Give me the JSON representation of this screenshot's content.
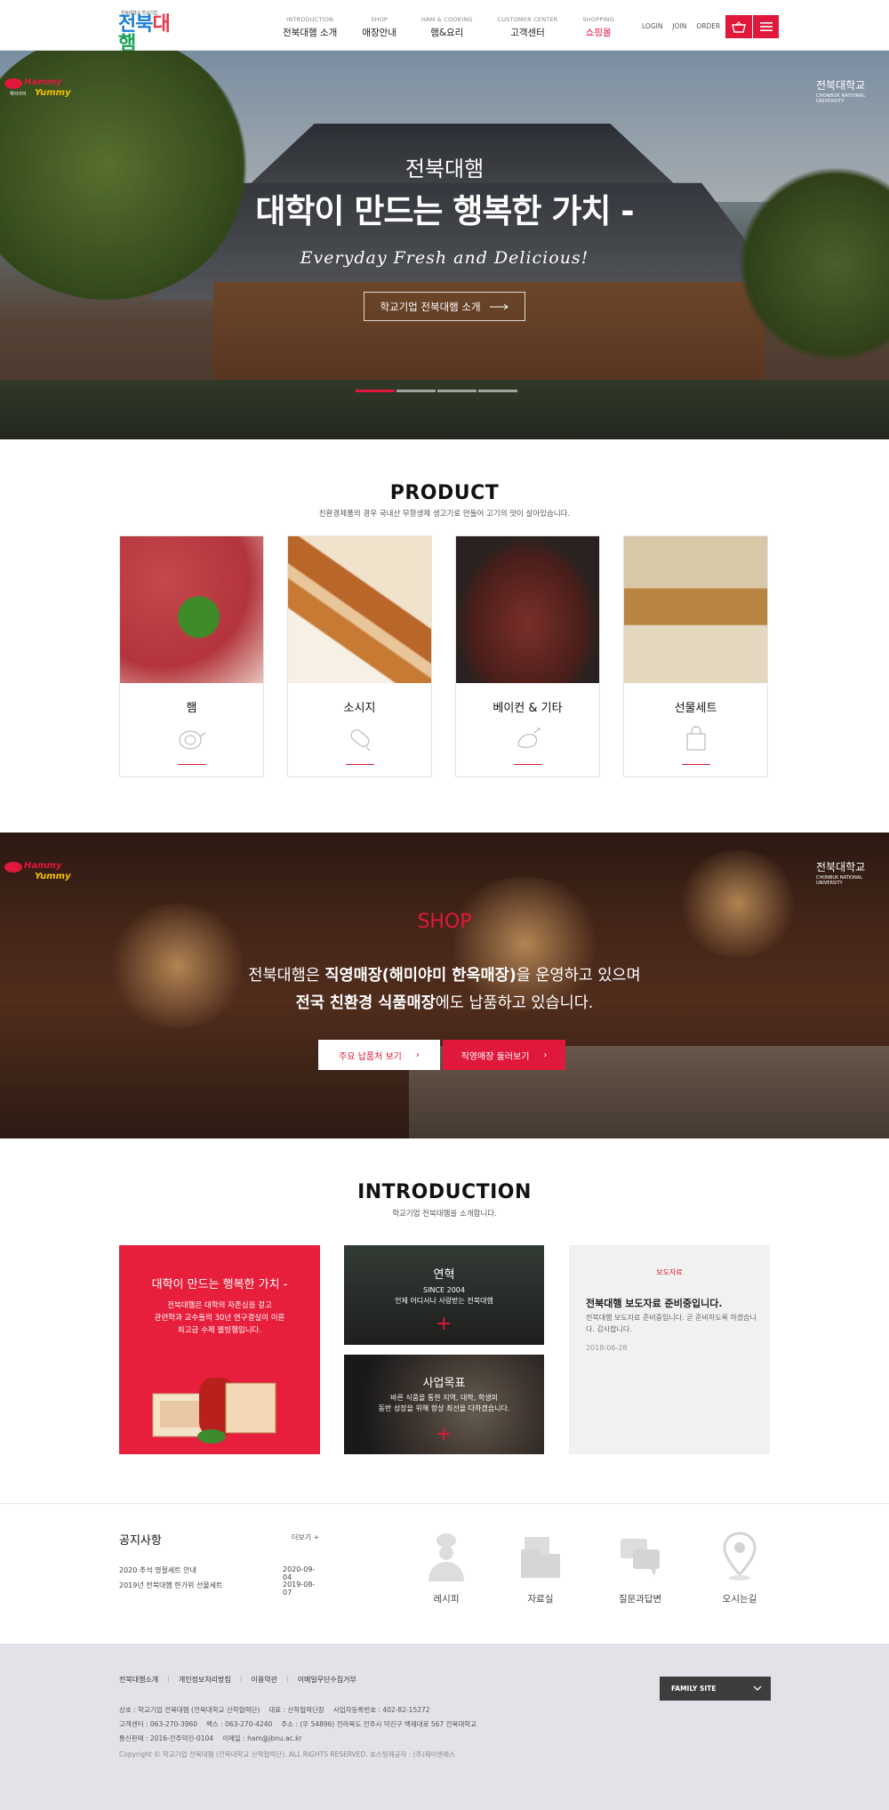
{
  "header": {
    "logo_sub": "전북대학교 학교기업",
    "logo_text": [
      "전북",
      "대",
      "햄"
    ],
    "nav": [
      {
        "en": "INTRODUCTION",
        "ko": "전북대햄 소개"
      },
      {
        "en": "SHOP",
        "ko": "매장안내"
      },
      {
        "en": "HAM & COOKING",
        "ko": "햄&요리"
      },
      {
        "en": "CUSTOMER CENTER",
        "ko": "고객센터"
      },
      {
        "en": "SHOPPING",
        "ko": "쇼핑몰"
      }
    ],
    "util": [
      "LOGIN",
      "JOIN",
      "ORDER"
    ]
  },
  "hero": {
    "brand_badge": "Hammy Yummy",
    "brand_badge_sub": "해미야미",
    "univ_badge": "전북대학교",
    "univ_badge_en": "CHONBUK NATIONAL UNIVERSITY",
    "title_small": "전북대햄",
    "title_big": "대학이 만드는 행복한 가치 -",
    "tagline": "Everyday Fresh and Delicious!",
    "cta": "학교기업 전북대햄 소개",
    "slide_count": 4,
    "active_slide": 1
  },
  "product": {
    "title": "PRODUCT",
    "subtitle": "친환경제품의 경우 국내산 무항생제 생고기로 만들어 고기의 맛이 살아있습니다.",
    "items": [
      {
        "name": "햄",
        "icon": "ham-icon"
      },
      {
        "name": "소시지",
        "icon": "sausage-icon"
      },
      {
        "name": "베이컨 & 기타",
        "icon": "chicken-icon"
      },
      {
        "name": "선물세트",
        "icon": "gift-bag-icon"
      }
    ]
  },
  "shop": {
    "title": "SHOP",
    "line1_a": "전북대햄은 ",
    "line1_b": "직영매장(해미야미 한옥매장)",
    "line1_c": "을 운영하고 있으며",
    "line2_a": "전국 친환경 식품매장",
    "line2_b": "에도 납품하고 있습니다.",
    "btn_partners": "주요 납품처 보기",
    "btn_store": "직영매장 둘러보기"
  },
  "intro": {
    "title": "INTRODUCTION",
    "subtitle": "학교기업 전북대햄을 소개합니다.",
    "value_title": "대학이 만드는 행복한 가치 -",
    "value_desc": [
      "전북대햄은 대학의 자존심을 걸고",
      "관련학과 교수들의 30년 연구결실이 이룬",
      "최고급 수제 웰빙햄입니다."
    ],
    "history_title": "연혁",
    "history_desc": [
      "SINCE 2004",
      "언제 어디서나 사랑받는 전북대햄"
    ],
    "goal_title": "사업목표",
    "goal_desc": [
      "바른 식품을 통한 지역, 대학, 학생의",
      "동반 성장을 위해 항상 최선을 다하겠습니다."
    ],
    "press_tag": "보도자료",
    "press_title": "전북대햄 보도자료 준비중입니다.",
    "press_desc": "전북대햄 보도자료 준비중입니다. 곧 준비하도록 하겠습니다. 감사합니다.",
    "press_date": "2018-06-28"
  },
  "notice": {
    "title": "공지사항",
    "more": "더보기 +",
    "rows": [
      {
        "title": "2020 추석 명절세트 안내",
        "date": "2020-09-04"
      },
      {
        "title": "2019년 전북대햄 한가위 선물세트",
        "date": "2019-08-07"
      }
    ]
  },
  "quick": [
    {
      "label": "레시피",
      "icon": "chef-icon"
    },
    {
      "label": "자료실",
      "icon": "folder-icon"
    },
    {
      "label": "질문과답변",
      "icon": "chat-bubbles-icon"
    },
    {
      "label": "오시는길",
      "icon": "map-pin-icon"
    }
  ],
  "footer": {
    "menu": [
      "전북대햄소개",
      "개인정보처리방침",
      "이용약관",
      "이메일무단수집거부"
    ],
    "info1": [
      "상호 : 학교기업 전북대햄 (전북대학교 산학협력단)",
      "대표 : 산학협력단장",
      "사업자등록번호 : 402-82-15272"
    ],
    "info2": [
      "고객센터 : 063-270-3960",
      "팩스 : 063-270-4240",
      "주소 : (우 54896) 전라북도 전주시 덕진구 백제대로 567 전북대학교"
    ],
    "info3": [
      "통신판매 : 2016-전주덕진-0104",
      "이메일 : ham@jbnu.ac.kr"
    ],
    "copyright": "Copyright © 학교기업 전북대햄 (전북대학교 산학협력단). ALL RIGHTS RESERVED. 호스팅제공자 : (주)제이엔에스",
    "family_site": "FAMILY SITE"
  }
}
